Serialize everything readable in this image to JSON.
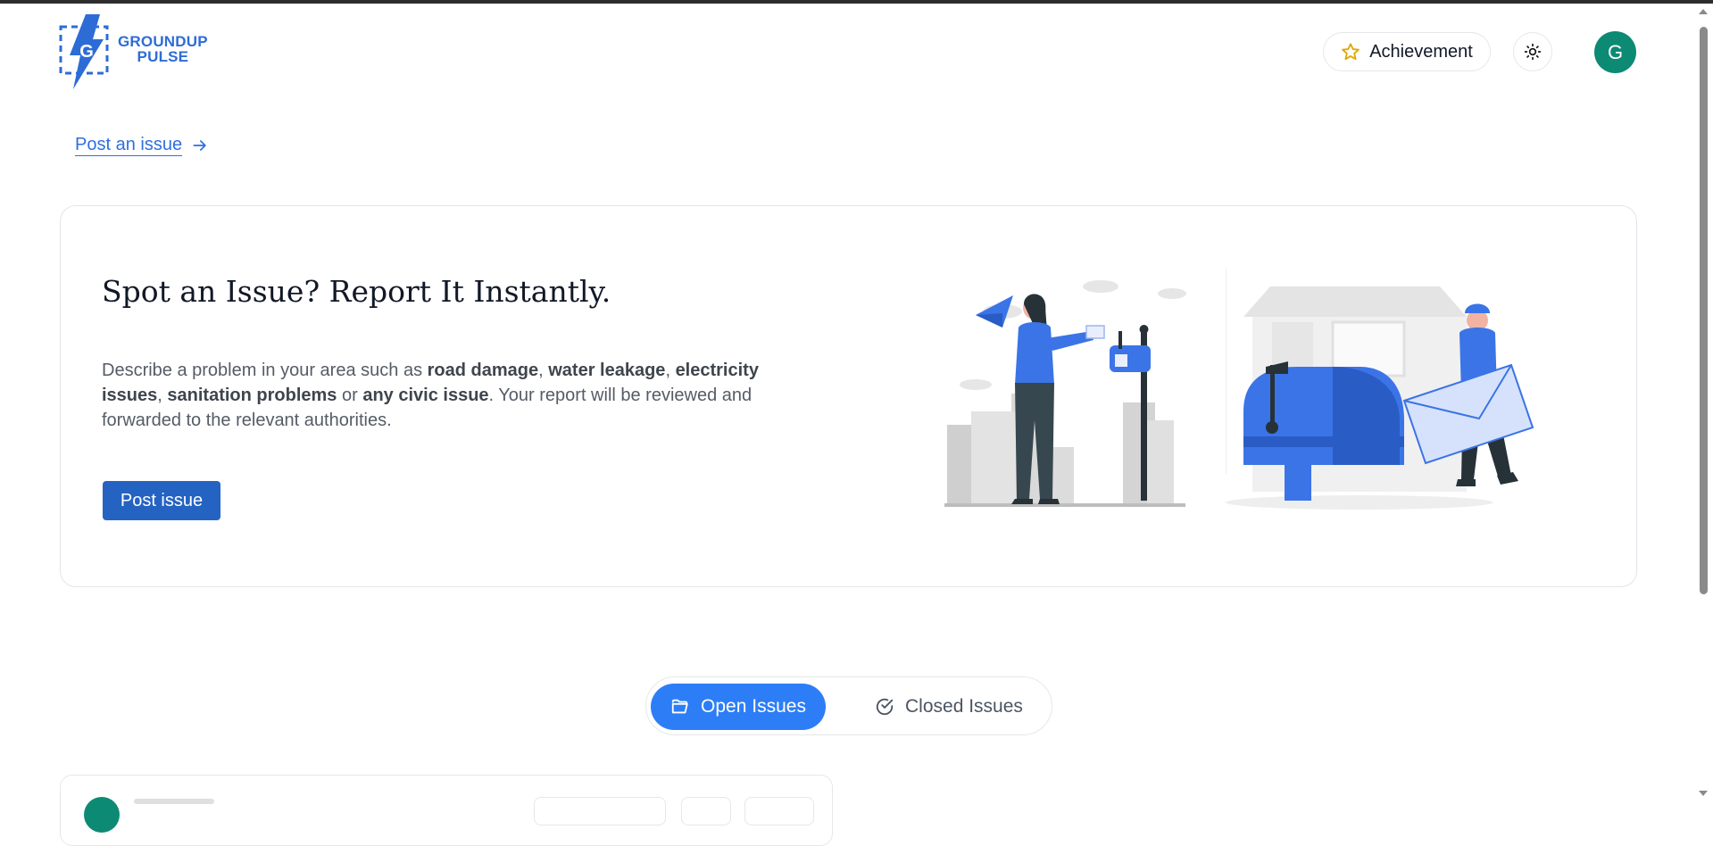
{
  "header": {
    "logo_line1": "GROUNDUP",
    "logo_line2": "PULSE",
    "logo_letter": "G",
    "achievement_label": "Achievement",
    "avatar_initial": "G"
  },
  "post_link": {
    "label": "Post an issue"
  },
  "hero": {
    "title": "Spot an Issue? Report It Instantly.",
    "desc_parts": {
      "p1": "Describe a problem in your area such as ",
      "b1": "road damage",
      "s1": ", ",
      "b2": "water leakage",
      "s2": ", ",
      "b3": "electricity issues",
      "s3": ", ",
      "b4": "sanitation problems",
      "s4": " or ",
      "b5": "any civic issue",
      "p2": ". Your report will be reviewed and forwarded to the relevant authorities."
    },
    "button_label": "Post issue"
  },
  "tabs": {
    "open_label": "Open Issues",
    "closed_label": "Closed Issues",
    "active": "open"
  },
  "colors": {
    "brand_blue": "#2d6cd6",
    "primary_button": "#2563c2",
    "active_tab": "#2d7ef6",
    "avatar": "#0d8a74",
    "star": "#e0a800"
  }
}
